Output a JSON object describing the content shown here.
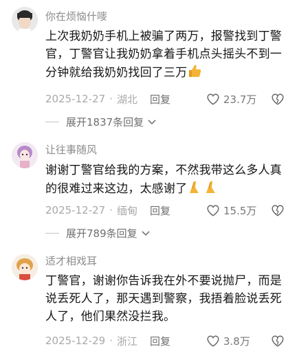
{
  "comments": [
    {
      "username": "你在烦恼什嘜",
      "text": "上次我奶奶手机上被骗了两万，报警找到丁警官，丁警官让我奶奶拿着手机点头摇头不到一分钟就给我奶奶找回了三万",
      "emoji": "thumbs-up",
      "date": "2025-12-27",
      "location": "湖北",
      "reply_label": "回复",
      "likes": "23.7万",
      "expand_label": "展开1837条回复"
    },
    {
      "username": "让往事随风",
      "text": "谢谢丁警官给我的方案，不然我带这么多人真的很难过来这边，太感谢了",
      "emoji": "praying-hands",
      "date": "2025-12-27",
      "location": "缅甸",
      "reply_label": "回复",
      "likes": "15.5万",
      "expand_label": "展开789条回复"
    },
    {
      "username": "适才相戏耳",
      "text": "丁警官，谢谢你告诉我在外不要说抛尸，而是说丢死人了，那天遇到警察，我捂着脸说丢死人了，他们果然没拦我。",
      "date": "2025-12-29",
      "location": "浙江",
      "reply_label": "回复",
      "likes": "3.8万"
    }
  ],
  "colors": {
    "username": "#8b8b8b",
    "meta": "#a8a8a8",
    "text": "#161616",
    "thumb": "#f5b335"
  }
}
